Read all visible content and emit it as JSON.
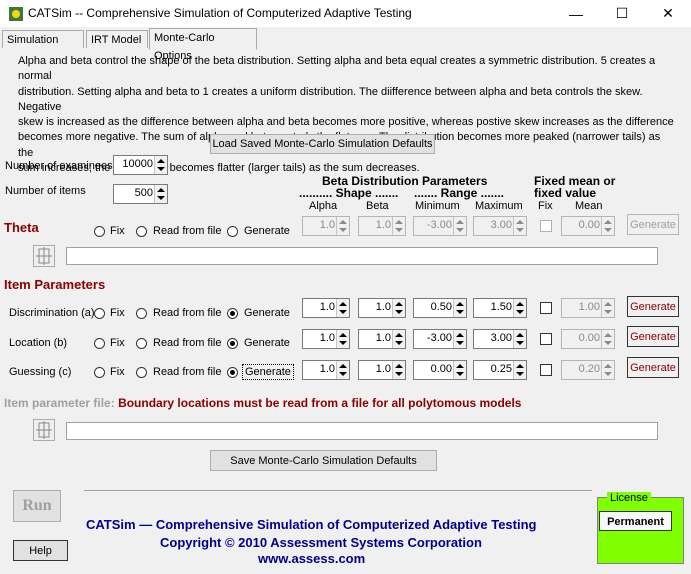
{
  "window": {
    "title": "CATSim -- Comprehensive Simulation of Computerized Adaptive Testing",
    "minimize": "—",
    "maximize": "☐",
    "close": "✕"
  },
  "tabs": [
    {
      "label": "Simulation Type",
      "active": false
    },
    {
      "label": "IRT Model",
      "active": false
    },
    {
      "label": "Monte-Carlo Options",
      "active": true
    }
  ],
  "description": {
    "line1": "Alpha and beta control the shape of the beta distribution.  Setting alpha and beta equal creates a symmetric distribution. 5 creates a normal",
    "line2": "distribution. Setting alpha and beta to 1 creates a uniform distribution. The diifference between alpha and beta controls the skew.  Negative",
    "line3": "skew is increased as the difference between alpha and beta becomes more positive, whereas postive skew increases as the difference",
    "line4": "becomes more negative.  The sum of alpha and beta controls the flatness.  The distribution becomes more peaked (narrower tails) as the",
    "line5": "sum increases; the distribution becomes flatter (larger tails) as the sum decreases."
  },
  "load_defaults_label": "Load Saved Monte-Carlo Simulation Defaults",
  "save_defaults_label": "Save Monte-Carlo Simulation Defaults",
  "examinees": {
    "label": "Number of examinees",
    "value": "10000"
  },
  "items": {
    "label": "Number of items",
    "value": "500"
  },
  "headers": {
    "beta_params": "Beta Distribution Parameters",
    "shape": ".......... Shape .......",
    "range": "....... Range .......",
    "fixed1": "Fixed mean or",
    "fixed2": "fixed value",
    "alpha": "Alpha",
    "beta": "Beta",
    "minimum": "Minimum",
    "maximum": "Maximum",
    "fix": "Fix",
    "mean": "Mean"
  },
  "radio_labels": {
    "fix": "Fix",
    "read": "Read from file",
    "generate": "Generate"
  },
  "generate_label": "Generate",
  "theta": {
    "label": "Theta",
    "alpha": "1.0",
    "beta": "1.0",
    "min": "-3.00",
    "max": "3.00",
    "mean": "0.00"
  },
  "item_params": {
    "label": "Item Parameters",
    "rows": [
      {
        "label": "Discrimination (a)",
        "alpha": "1.0",
        "beta": "1.0",
        "min": "0.50",
        "max": "1.50",
        "mean": "1.00"
      },
      {
        "label": "Location (b)",
        "alpha": "1.0",
        "beta": "1.0",
        "min": "-3.00",
        "max": "3.00",
        "mean": "0.00"
      },
      {
        "label": "Guessing (c)",
        "alpha": "1.0",
        "beta": "1.0",
        "min": "0.00",
        "max": "0.25",
        "mean": "0.20"
      }
    ]
  },
  "item_file": {
    "label": "Item parameter file:",
    "warning": "Boundary locations must be read from a file for all polytomous models"
  },
  "run_label": "Run",
  "help_label": "Help",
  "footer": {
    "line1": "CATSim — Comprehensive Simulation of Computerized Adaptive Testing",
    "line2": "Copyright © 2010  Assessment Systems Corporation",
    "line3": "www.assess.com"
  },
  "license": {
    "label": "License",
    "value": "Permanent"
  },
  "colors": {
    "accent": "#8b0000",
    "footer": "#00008b",
    "license_bg": "#80ff00"
  }
}
